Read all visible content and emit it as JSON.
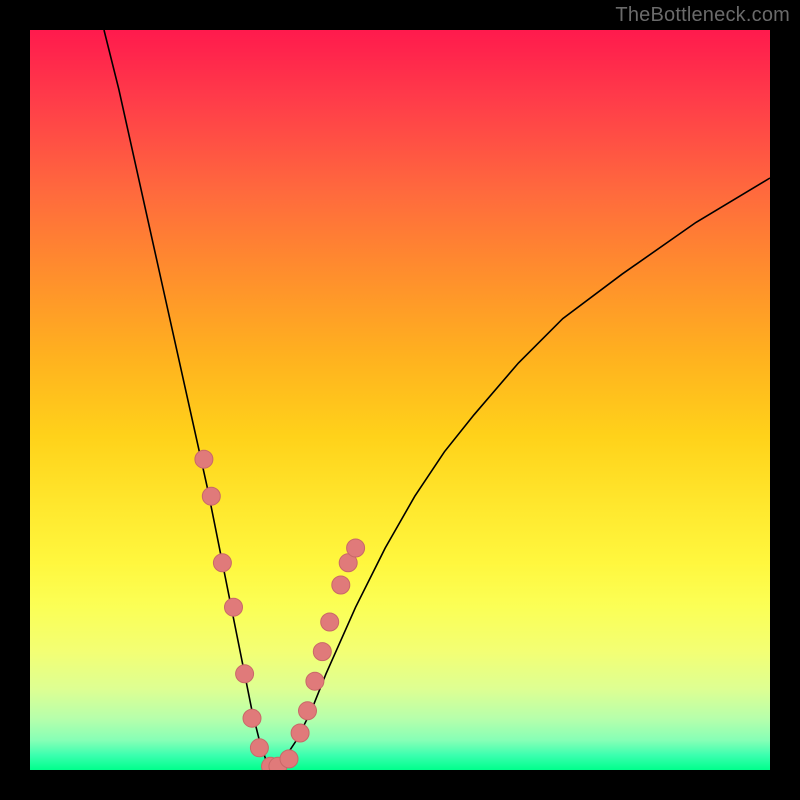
{
  "watermark": "TheBottleneck.com",
  "colors": {
    "background": "#000000",
    "curve_stroke": "#000000",
    "marker_fill": "#e07a7a",
    "marker_stroke": "#c96868"
  },
  "chart_data": {
    "type": "line",
    "title": "",
    "xlabel": "",
    "ylabel": "",
    "xlim": [
      0,
      100
    ],
    "ylim": [
      0,
      100
    ],
    "curve": {
      "x": [
        10,
        12,
        14,
        16,
        18,
        20,
        22,
        24,
        26,
        27,
        28,
        29,
        30,
        31,
        32,
        33,
        34,
        36,
        38,
        40,
        44,
        48,
        52,
        56,
        60,
        66,
        72,
        80,
        90,
        100
      ],
      "y": [
        100,
        92,
        83,
        74,
        65,
        56,
        47,
        38,
        28,
        23,
        18,
        13,
        8,
        4,
        1,
        0,
        1,
        4,
        8,
        13,
        22,
        30,
        37,
        43,
        48,
        55,
        61,
        67,
        74,
        80
      ]
    },
    "markers": {
      "x": [
        23.5,
        24.5,
        26.0,
        27.5,
        29.0,
        30.0,
        31.0,
        32.5,
        33.5,
        35.0,
        36.5,
        37.5,
        38.5,
        39.5,
        40.5,
        42.0,
        43.0,
        44.0
      ],
      "y": [
        42,
        37,
        28,
        22,
        13,
        7,
        3,
        0.5,
        0.5,
        1.5,
        5,
        8,
        12,
        16,
        20,
        25,
        28,
        30
      ]
    }
  }
}
